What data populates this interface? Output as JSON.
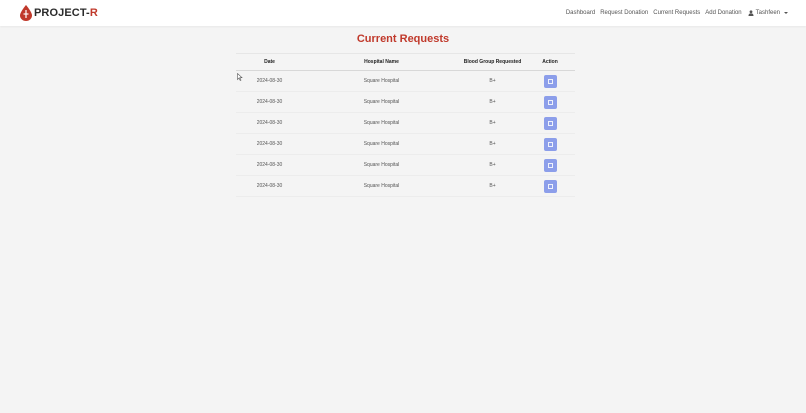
{
  "brand": {
    "name_prefix": "PROJECT-",
    "name_suffix": "R",
    "logo_color": "#c0392b"
  },
  "nav": {
    "links": [
      "Dashboard",
      "Request Donation",
      "Current Requests",
      "Add Donation"
    ],
    "user_name": "Tashfeen"
  },
  "page": {
    "title": "Current Requests",
    "title_color": "#c0392b"
  },
  "table": {
    "headers": {
      "date": "Date",
      "hospital": "Hospital Name",
      "blood": "Blood Group Requested",
      "action": "Action"
    },
    "rows": [
      {
        "date": "2024-08-30",
        "hospital": "Square Hospital",
        "blood": "B+"
      },
      {
        "date": "2024-08-30",
        "hospital": "Square Hospital",
        "blood": "B+"
      },
      {
        "date": "2024-08-30",
        "hospital": "Square Hospital",
        "blood": "B+"
      },
      {
        "date": "2024-08-30",
        "hospital": "Square Hospital",
        "blood": "B+"
      },
      {
        "date": "2024-08-30",
        "hospital": "Square Hospital",
        "blood": "B+"
      },
      {
        "date": "2024-08-30",
        "hospital": "Square Hospital",
        "blood": "B+"
      }
    ],
    "action_button_color": "#8c9eea",
    "action_icon": "document-icon"
  }
}
